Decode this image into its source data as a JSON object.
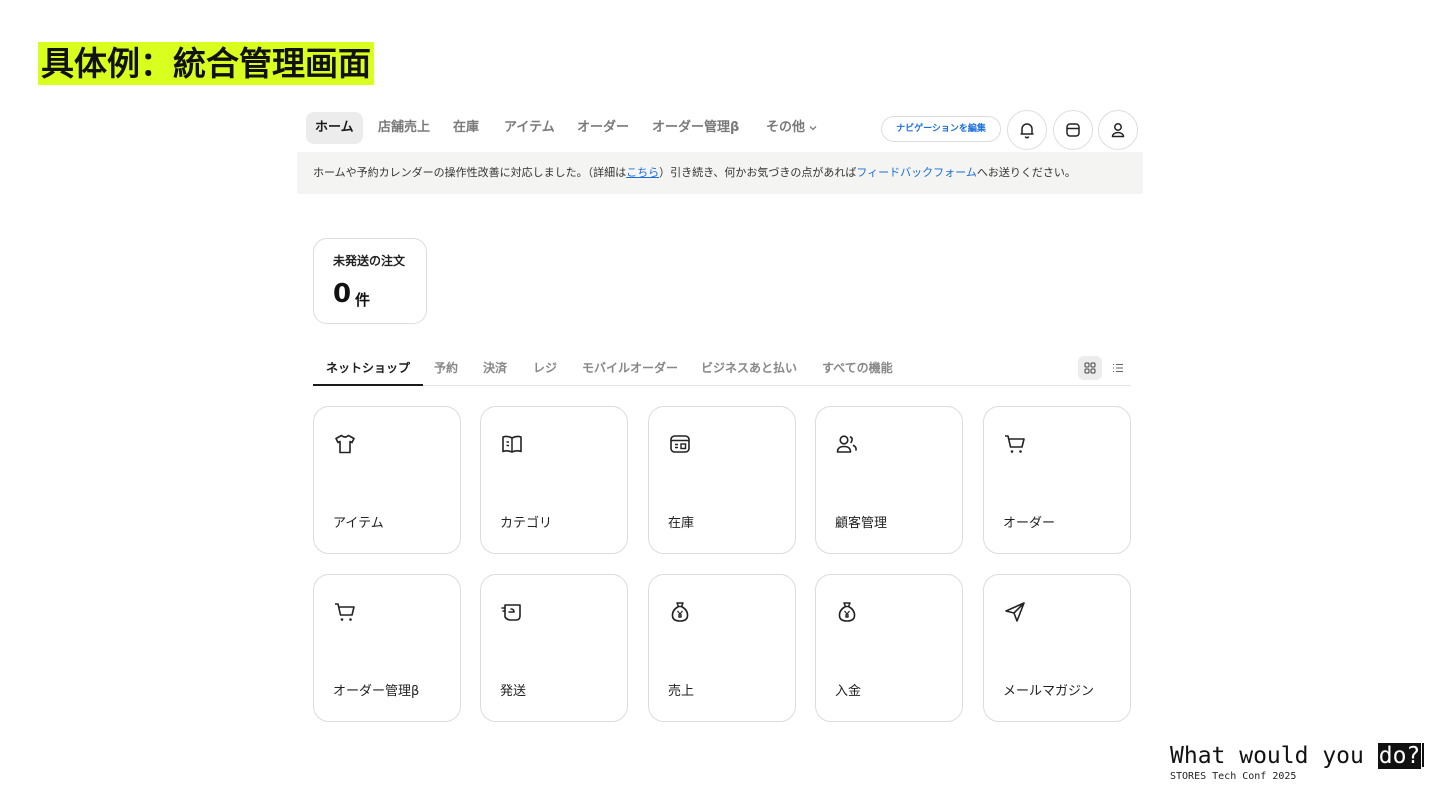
{
  "slide": {
    "title": "具体例：統合管理画面"
  },
  "topnav": {
    "items": [
      "ホーム",
      "店舗売上",
      "在庫",
      "アイテム",
      "オーダー",
      "オーダー管理β",
      "その他"
    ],
    "edit_button": "ナビゲーションを編集"
  },
  "notice": {
    "text_before": "ホームや予約カレンダーの操作性改善に対応しました。（詳細は",
    "details_link": "こちら",
    "text_middle": "）引き続き、何かお気づきの点があれば",
    "feedback_link": "フィードバックフォーム",
    "text_after": "へお送りください。"
  },
  "summary": {
    "label": "未発送の注文",
    "count": "0",
    "unit": "件"
  },
  "tabs": [
    "ネットショップ",
    "予約",
    "決済",
    "レジ",
    "モバイルオーダー",
    "ビジネスあと払い",
    "すべての機能"
  ],
  "tiles": [
    {
      "label": "アイテム",
      "icon": "tshirt-icon"
    },
    {
      "label": "カテゴリ",
      "icon": "book-icon"
    },
    {
      "label": "在庫",
      "icon": "inventory-box-icon"
    },
    {
      "label": "顧客管理",
      "icon": "users-icon"
    },
    {
      "label": "オーダー",
      "icon": "cart-icon"
    },
    {
      "label": "オーダー管理β",
      "icon": "cart-icon"
    },
    {
      "label": "発送",
      "icon": "shipping-box-icon"
    },
    {
      "label": "売上",
      "icon": "money-bag-icon"
    },
    {
      "label": "入金",
      "icon": "money-bag-icon"
    },
    {
      "label": "メールマガジン",
      "icon": "paper-plane-icon"
    }
  ],
  "footer": {
    "tagline_lead": "What would you ",
    "tagline_highlight": "do?",
    "event": "STORES Tech Conf 2025"
  },
  "colors": {
    "highlight": "#d8ff1e",
    "link": "#1a6ed8"
  }
}
